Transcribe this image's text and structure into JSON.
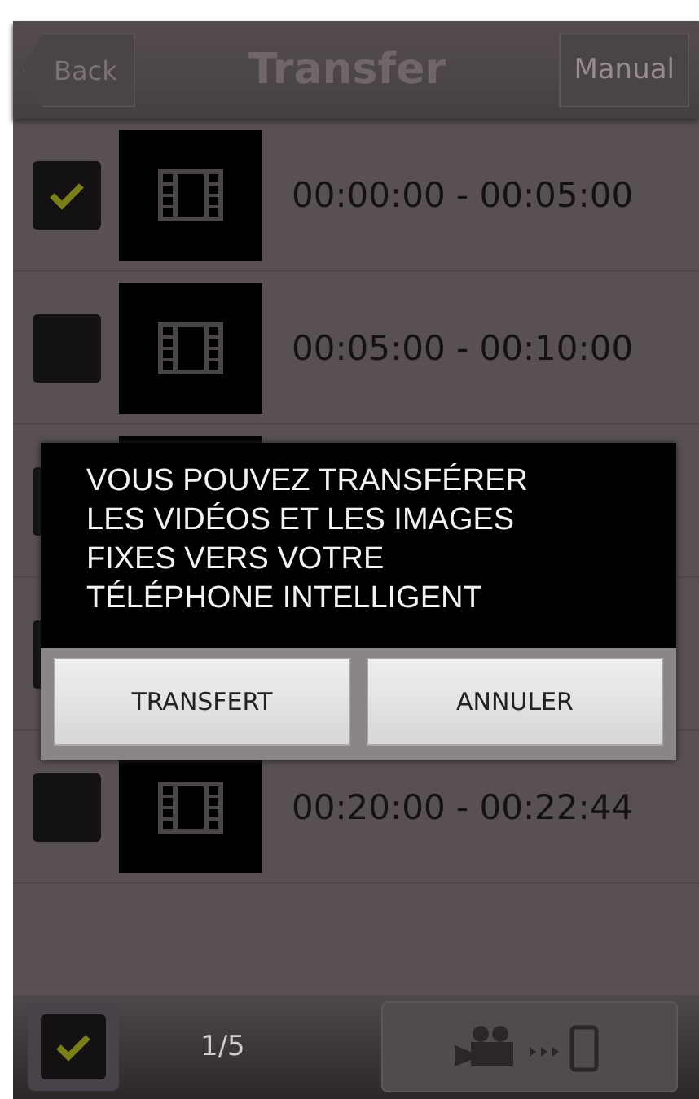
{
  "header": {
    "back": "Back",
    "title": "Transfer",
    "manual": "Manual"
  },
  "rows": [
    {
      "time": "00:00:00 - 00:05:00",
      "checked": true
    },
    {
      "time": "00:05:00 - 00:10:00",
      "checked": false
    },
    {},
    {},
    {
      "time": "00:20:00 - 00:22:44",
      "checked": false
    }
  ],
  "footer": {
    "select_all": true,
    "count": "1/5"
  },
  "dialog": {
    "message": "VOUS POUVEZ TRANSFÉRER LES VIDÉOS ET LES IMAGES FIXES VERS VOTRE TÉLÉPHONE INTELLIGENT",
    "buttons": [
      "TRANSFERT",
      "ANNULER"
    ]
  }
}
